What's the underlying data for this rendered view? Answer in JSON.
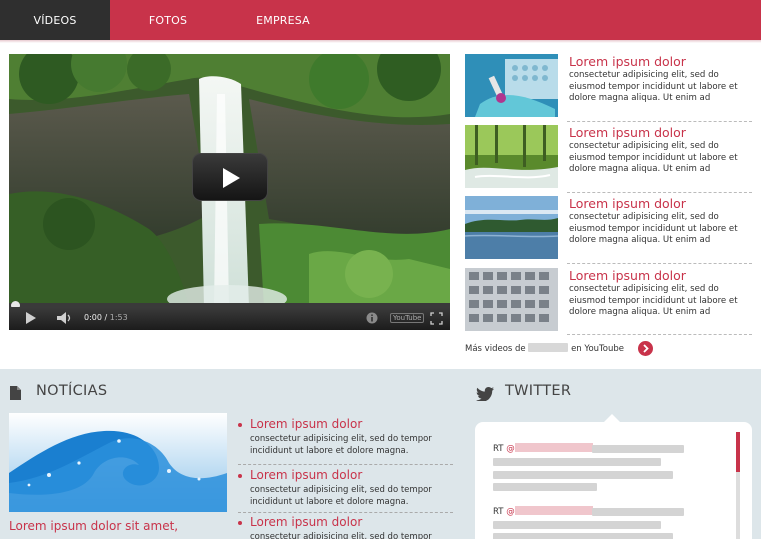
{
  "nav": {
    "items": [
      {
        "label": "VÍDEOS",
        "active": true
      },
      {
        "label": "FOTOS",
        "active": false
      },
      {
        "label": "EMPRESA",
        "active": false
      }
    ],
    "accent": "#c8334a"
  },
  "video": {
    "current_time": "0:00",
    "duration": "1:53",
    "separator": "/",
    "youtube_label": "YouTube",
    "progress": 0
  },
  "related": {
    "items": [
      {
        "title": "Lorem ipsum dolor",
        "desc": "consectetur adipisicing elit, sed do eiusmod tempor incididunt ut labore et dolore magna aliqua. Ut enim ad",
        "thumb": "lab-thumbnail"
      },
      {
        "title": "Lorem ipsum dolor",
        "desc": "consectetur adipisicing elit, sed do eiusmod tempor incididunt ut labore et dolore magna aliqua. Ut enim ad",
        "thumb": "forest-stream-thumbnail"
      },
      {
        "title": "Lorem ipsum dolor",
        "desc": "consectetur adipisicing elit, sed do eiusmod tempor incididunt ut labore et dolore magna aliqua. Ut enim ad",
        "thumb": "lake-thumbnail"
      },
      {
        "title": "Lorem ipsum dolor",
        "desc": "consectetur adipisicing elit, sed do eiusmod tempor incididunt ut labore et dolore magna aliqua. Ut enim ad",
        "thumb": "building-thumbnail"
      }
    ],
    "more_prefix": "Más videos de",
    "more_suffix": "en YouToube"
  },
  "news": {
    "title": "NOTÍCIAS",
    "caption": "Lorem ipsum dolor sit amet,",
    "items": [
      {
        "title": "Lorem ipsum dolor",
        "desc": "consectetur adipisicing elit, sed do tempor incididunt ut labore et dolore magna."
      },
      {
        "title": "Lorem ipsum dolor",
        "desc": "consectetur adipisicing elit, sed do tempor incididunt ut labore et dolore magna."
      },
      {
        "title": "Lorem ipsum dolor",
        "desc": "consectetur adipisicing elit, sed do tempor"
      }
    ]
  },
  "twitter": {
    "title": "TWITTER",
    "tweets": [
      {
        "prefix": "RT",
        "at": "@"
      },
      {
        "prefix": "RT",
        "at": "@"
      }
    ]
  }
}
